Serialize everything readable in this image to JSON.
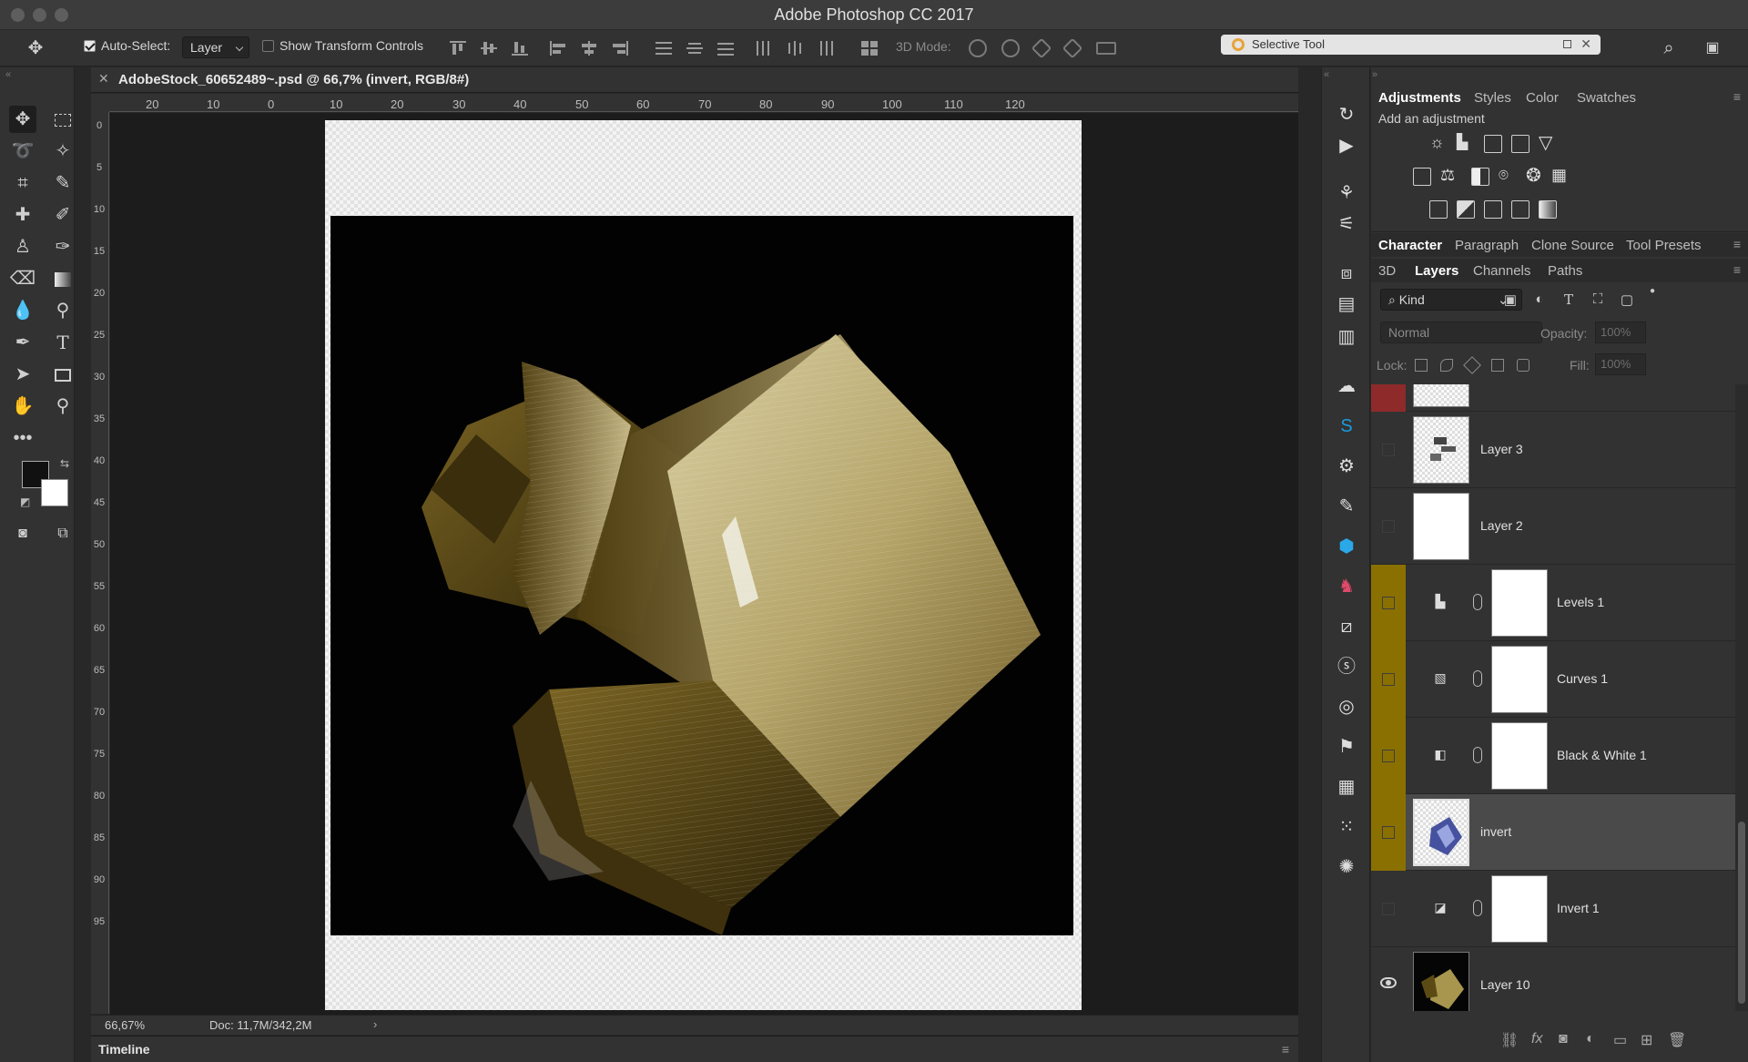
{
  "window": {
    "title": "Adobe Photoshop CC 2017"
  },
  "options_bar": {
    "auto_select_label": "Auto-Select:",
    "auto_select_checked": true,
    "auto_select_target": "Layer",
    "show_transform_label": "Show Transform Controls",
    "show_transform_checked": false,
    "mode_3d_label": "3D Mode:",
    "selective_tool_label": "Selective Tool"
  },
  "document": {
    "tab_title": "AdobeStock_60652489~.psd @ 66,7% (invert, RGB/8#)",
    "ruler_top": [
      "20",
      "10",
      "0",
      "10",
      "20",
      "30",
      "40",
      "50",
      "60",
      "70",
      "80",
      "90",
      "100",
      "110",
      "120"
    ],
    "ruler_left": [
      "0",
      "5",
      "10",
      "15",
      "20",
      "25",
      "30",
      "35",
      "40",
      "45",
      "50",
      "55",
      "60",
      "65",
      "70",
      "75",
      "80",
      "85",
      "90",
      "95"
    ],
    "zoom": "66,67%",
    "doc_size": "Doc: 11,7M/342,2M"
  },
  "timeline": {
    "label": "Timeline"
  },
  "panels": {
    "top_tabs": [
      "Adjustments",
      "Styles",
      "Color",
      "Swatches"
    ],
    "top_active": "Adjustments",
    "add_adjustment": "Add an adjustment",
    "mid_tabs": [
      "Character",
      "Paragraph",
      "Clone Source",
      "Tool Presets"
    ],
    "mid_active": "Character",
    "layer_tabs": [
      "3D",
      "Layers",
      "Channels",
      "Paths"
    ],
    "layer_active": "Layers",
    "filter_kind": "Kind",
    "blend_mode": "Normal",
    "opacity_label": "Opacity:",
    "opacity_value": "100%",
    "lock_label": "Lock:",
    "fill_label": "Fill:",
    "fill_value": "100%"
  },
  "layers": [
    {
      "name": "",
      "color": "#8e2a2a",
      "type": "pixel",
      "visible": false,
      "selected": false
    },
    {
      "name": "Layer 3",
      "color": "",
      "type": "pixel",
      "visible": false,
      "selected": false
    },
    {
      "name": "Layer 2",
      "color": "",
      "type": "pixel",
      "visible": false,
      "selected": false
    },
    {
      "name": "Levels 1",
      "color": "#8a7000",
      "type": "adjustment",
      "icon": "levels-icon",
      "visible": false,
      "selected": false
    },
    {
      "name": "Curves 1",
      "color": "#8a7000",
      "type": "adjustment",
      "icon": "curves-icon",
      "visible": false,
      "selected": false
    },
    {
      "name": "Black & White 1",
      "color": "#8a7000",
      "type": "adjustment",
      "icon": "black-white-icon",
      "visible": false,
      "selected": false
    },
    {
      "name": "invert",
      "color": "#8a7000",
      "type": "pixel",
      "visible": false,
      "selected": true
    },
    {
      "name": "Invert 1",
      "color": "",
      "type": "adjustment",
      "icon": "invert-icon",
      "visible": false,
      "selected": false
    },
    {
      "name": "Layer 10",
      "color": "",
      "type": "pixel",
      "visible": true,
      "selected": false
    }
  ],
  "colors": {
    "accent_yellow": "#8a7000",
    "accent_red": "#8e2a2a",
    "panel_bg": "#323232",
    "canvas_bg": "#1c1c1c"
  }
}
